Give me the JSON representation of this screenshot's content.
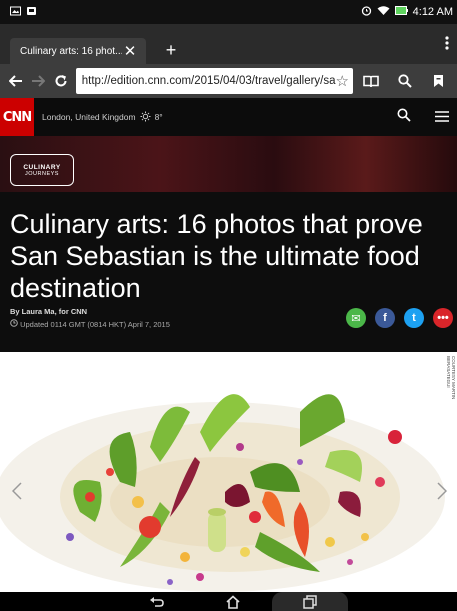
{
  "status": {
    "time": "4:12 AM"
  },
  "tab": {
    "title": "Culinary arts: 16 phot...",
    "close": "✕",
    "new": "+"
  },
  "browser": {
    "url": "http://edition.cnn.com/2015/04/03/travel/gallery/sa",
    "icons": [
      "back-icon",
      "forward-icon",
      "reload-icon",
      "star-icon",
      "reader-icon",
      "search-icon",
      "bookmark-icon",
      "menu-icon"
    ]
  },
  "cnn": {
    "logo": "CNN",
    "location": "London, United Kingdom",
    "temperature": "8°"
  },
  "banner": {
    "badge_line1": "CULINARY",
    "badge_line2": "JOURNEYS"
  },
  "article": {
    "headline": "Culinary arts: 16 photos that prove San Sebastian is the ultimate food destination",
    "byline": "By Laura Ma, for CNN",
    "updated": "Updated 0114 GMT (0814 HKT) April 7, 2015",
    "photo_credit": "COURTESY MARTIN BERASATEGUI"
  },
  "share": {
    "email": {
      "symbol": "✉",
      "color": "#4bb749"
    },
    "facebook": {
      "symbol": "f",
      "color": "#3b5998"
    },
    "twitter": {
      "symbol": "t",
      "color": "#1da1f2"
    },
    "more": {
      "symbol": "•••",
      "color": "#d9252a"
    }
  },
  "colors": {
    "cnn_red": "#cc0000",
    "toolbar": "#3d3d3d",
    "tabbar": "#2b2b2b"
  }
}
